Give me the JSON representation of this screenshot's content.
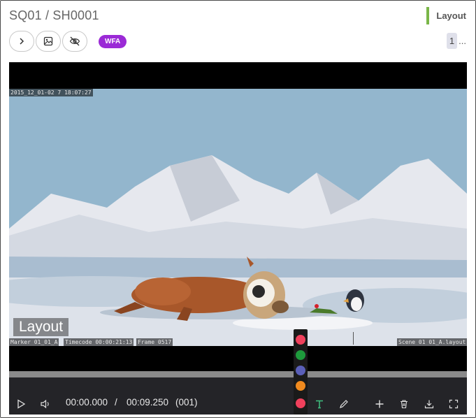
{
  "header": {
    "title": "SQ01 / SH0001",
    "task_type": "Layout",
    "task_color": "#7ab648"
  },
  "toolbar": {
    "buttons": [
      {
        "name": "next",
        "icon": "chevron-right-icon"
      },
      {
        "name": "preview",
        "icon": "image-icon"
      },
      {
        "name": "visibility",
        "icon": "eye-off-icon"
      }
    ],
    "status": "WFA",
    "status_color": "#9b2ad6",
    "version": "1",
    "version_more": "..."
  },
  "video": {
    "burnin_top": "2015_12_01-02 7 18:07:27",
    "burnin_marker": "Marker 01_01_A",
    "burnin_timecode": "Timecode 00:00:21:13",
    "burnin_frame": "Frame 0517",
    "burnin_scene": "Scene 01 01_A.layout",
    "stamp": "Layout"
  },
  "controls": {
    "current_time": "00:00.000",
    "separator": "/",
    "total_time": "00:09.250",
    "frame": "(001)"
  },
  "palette": {
    "colors": [
      "#f0405c",
      "#1e9a3c",
      "#5a5fb8",
      "#f08a1e"
    ],
    "active_color": "#f0405c"
  }
}
